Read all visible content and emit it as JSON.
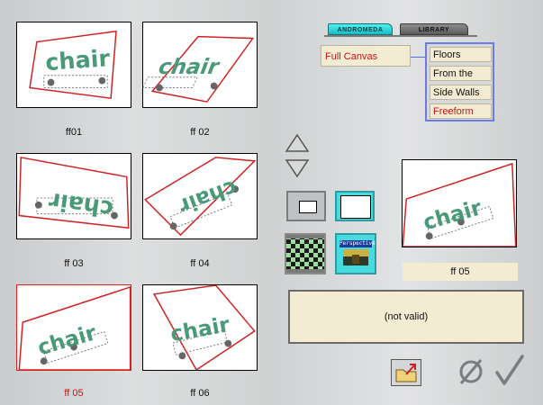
{
  "thumbnails": [
    {
      "label": "ff01",
      "selected": false
    },
    {
      "label": "ff 02",
      "selected": false
    },
    {
      "label": "ff 03",
      "selected": false
    },
    {
      "label": "ff 04",
      "selected": false
    },
    {
      "label": "ff 05",
      "selected": true
    },
    {
      "label": "ff 06",
      "selected": false
    }
  ],
  "thumbnail_text": "chair",
  "tabs": {
    "andromeda": "ANDROMEDA",
    "library": "LIBRARY"
  },
  "full_canvas": "Full Canvas",
  "modes": [
    "Floors",
    "From the Top",
    "Side Walls",
    "Freeform"
  ],
  "active_mode": "Freeform",
  "perspective_label": "Perspective",
  "preview_label": "ff 05",
  "status_text": "(not valid)",
  "colors": {
    "accent_red": "#d01010",
    "cyan": "#47dbe0",
    "panel_bg": "#f3ecd3",
    "mode_border": "#6b7de0",
    "chair_green": "#4a9a7a"
  },
  "icons": {
    "up": "triangle-up-icon",
    "down": "triangle-down-icon",
    "folder": "folder-export-icon",
    "cancel": "null-circle-icon",
    "ok": "checkmark-icon"
  }
}
